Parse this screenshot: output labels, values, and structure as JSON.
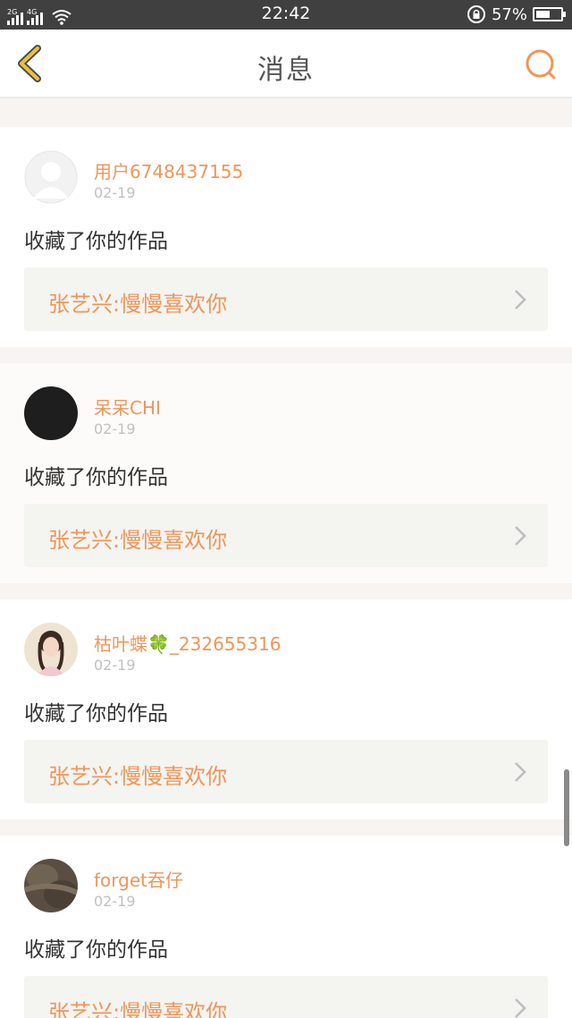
{
  "status_bar": {
    "network_1": "2G",
    "network_2": "4G",
    "time": "22:42",
    "battery_percent": "57%",
    "battery_level": 0.57
  },
  "header": {
    "title": "消息",
    "back_icon": "chevron-left-icon",
    "search_icon": "search-icon"
  },
  "messages": [
    {
      "username": "用户6748437155",
      "date": "02-19",
      "action": "收藏了你的作品",
      "work": "张艺兴:慢慢喜欢你",
      "avatar": "default-avatar"
    },
    {
      "username": "呆呆CHI",
      "date": "02-19",
      "action": "收藏了你的作品",
      "work": "张艺兴:慢慢喜欢你",
      "avatar": "black-avatar"
    },
    {
      "username": "枯叶蝶🍀_232655316",
      "date": "02-19",
      "action": "收藏了你的作品",
      "work": "张艺兴:慢慢喜欢你",
      "avatar": "photo-avatar"
    },
    {
      "username": "forget吞仔",
      "date": "02-19",
      "action": "收藏了你的作品",
      "work": "张艺兴:慢慢喜欢你",
      "avatar": "photo-avatar"
    }
  ],
  "colors": {
    "accent": "#f0955a",
    "back_icon": "#e8c23a",
    "status_bar_bg": "#404040"
  }
}
